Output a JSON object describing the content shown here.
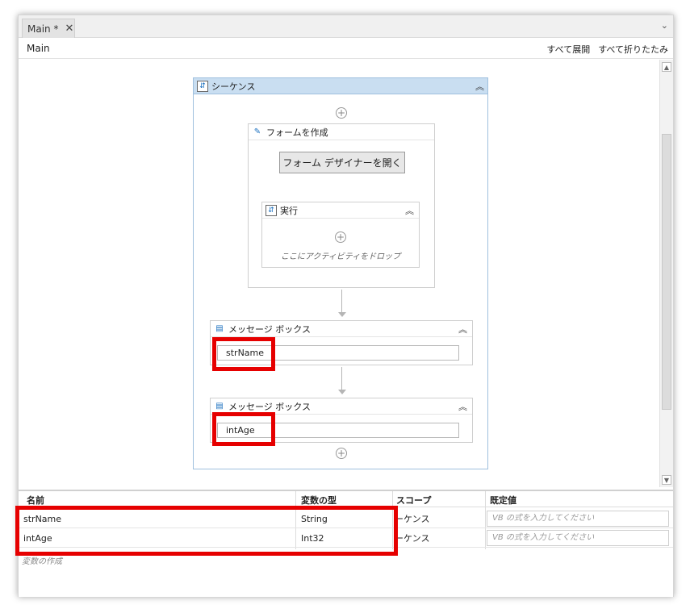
{
  "tab": {
    "label": "Main *",
    "close": "✕"
  },
  "header": {
    "title": "Main",
    "expand_all": "すべて展開",
    "collapse_all": "すべて折りたたみ"
  },
  "sequence": {
    "title": "シーケンス"
  },
  "form": {
    "title": "フォームを作成",
    "open_designer": "フォーム デザイナーを開く"
  },
  "run": {
    "title": "実行",
    "drop_hint": "ここにアクティビティをドロップ"
  },
  "message_boxes": [
    {
      "title": "メッセージ ボックス",
      "value": "strName"
    },
    {
      "title": "メッセージ ボックス",
      "value": "intAge"
    }
  ],
  "variables": {
    "columns": {
      "name": "名前",
      "type": "変数の型",
      "scope": "スコープ",
      "default": "既定値"
    },
    "rows": [
      {
        "name": "strName",
        "type": "String",
        "scope": "ーケンス",
        "default_placeholder": "VB の式を入力してください"
      },
      {
        "name": "intAge",
        "type": "Int32",
        "scope": "ーケンス",
        "default_placeholder": "VB の式を入力してください"
      }
    ],
    "create": "変数の作成"
  },
  "colors": {
    "highlight": "#e60000",
    "sequence_header": "#c9def1",
    "accent": "#1a6fbf"
  },
  "icons": [
    "close-icon",
    "chevron-down-icon",
    "sequence-icon",
    "collapse-icon",
    "form-edit-icon",
    "message-icon",
    "add-icon"
  ]
}
